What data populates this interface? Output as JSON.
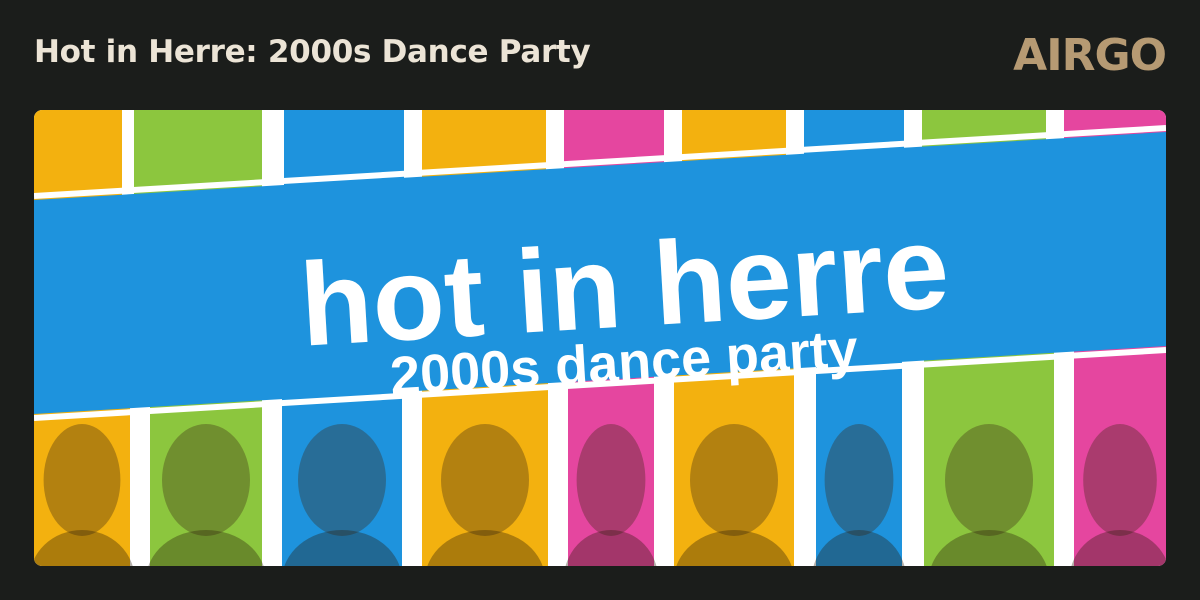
{
  "header": {
    "title": "Hot in Herre: 2000s Dance Party",
    "logo_text": "AIRGO"
  },
  "banner": {
    "headline": "hot in herre",
    "subheadline": "2000s dance party",
    "colors": {
      "orange": "#f3b10f",
      "green": "#8cc63e",
      "blue": "#1e93dd",
      "pink": "#e5469f",
      "white": "#ffffff"
    },
    "top_stripes": [
      "orange",
      "green",
      "blue",
      "orange",
      "pink",
      "orange",
      "blue",
      "green",
      "pink"
    ],
    "bottom_panels": [
      {
        "color": "orange",
        "icon": "portrait-1"
      },
      {
        "color": "green",
        "icon": "portrait-2"
      },
      {
        "color": "blue",
        "icon": "portrait-3"
      },
      {
        "color": "orange",
        "icon": "portrait-4"
      },
      {
        "color": "pink",
        "icon": "portrait-5"
      },
      {
        "color": "orange",
        "icon": "portrait-6"
      },
      {
        "color": "blue",
        "icon": "portrait-7"
      },
      {
        "color": "green",
        "icon": "portrait-8"
      },
      {
        "color": "pink",
        "icon": "portrait-9"
      }
    ]
  }
}
